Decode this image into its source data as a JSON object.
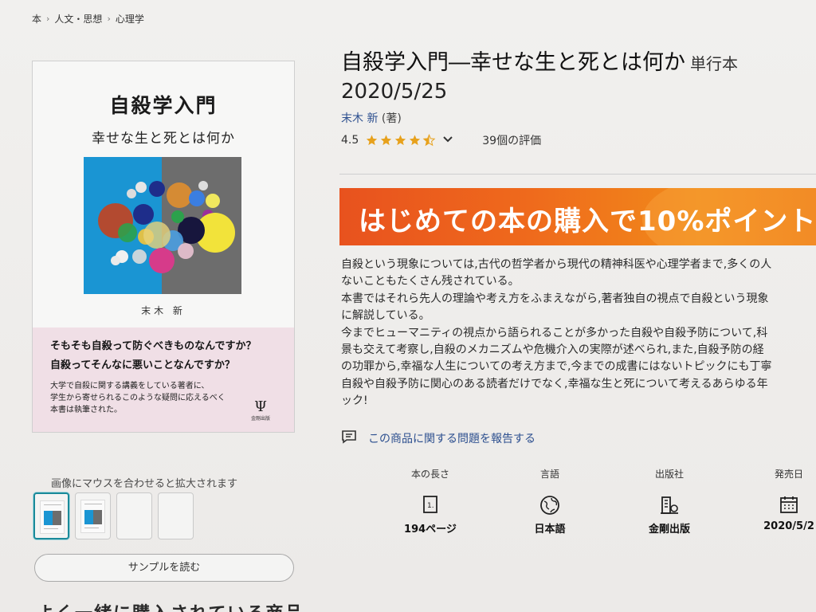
{
  "breadcrumb": [
    "本",
    "人文・思想",
    "心理学"
  ],
  "cover": {
    "title": "自殺学入門",
    "subtitle": "幸せな生と死とは何か",
    "author": "末木 新",
    "question1": "そもそも自殺って防ぐべきものなんですか？",
    "question2": "自殺ってそんなに悪いことなんですか？",
    "blurb": [
      "大学で自殺に関する講義をしている著者に、",
      "学生から寄せられるこのような疑問に応えるべく",
      "本書は執筆された。"
    ],
    "publisher_mark": "Ψ",
    "publisher_name": "金剛出版"
  },
  "hover_hint": "画像にマウスを合わせると拡大されます",
  "sample_button": "サンプルを読む",
  "bottom_cut_text": "よく一緒に購入されている商品",
  "product": {
    "title": "自殺学入門―幸せな生と死とは何か",
    "format": "単行本",
    "date": "2020/5/25",
    "author": "末木 新",
    "author_role": "(著)",
    "rating_value": "4.5",
    "rating_stars": 4.5,
    "rating_count": "39個の評価"
  },
  "promo": {
    "text": "はじめての本の購入で10%ポイント",
    "color_start": "#e8521e",
    "color_end": "#ee7a14"
  },
  "description": [
    "自殺という現象については,古代の哲学者から現代の精神科医や心理学者まで,多くの人",
    "ないこともたくさん残されている。",
    "本書ではそれら先人の理論や考え方をふまえながら,著者独自の視点で自殺という現象",
    "に解説している。",
    "今までヒューマニティの視点から語られることが多かった自殺や自殺予防について,科",
    "景も交えて考察し,自殺のメカニズムや危機介入の実際が述べられ,また,自殺予防の経",
    "の功罪から,幸福な人生についての考え方まで,今までの成書にはないトピックにも丁寧",
    "自殺や自殺予防に関心のある読者だけでなく,幸福な生と死について考えるあらゆる年",
    "ック!"
  ],
  "report_link": "この商品に関する問題を報告する",
  "attributes": [
    {
      "label": "本の長さ",
      "icon": "page-count-icon",
      "value": "194ページ"
    },
    {
      "label": "言語",
      "icon": "globe-icon",
      "value": "日本語"
    },
    {
      "label": "出版社",
      "icon": "building-icon",
      "value": "金剛出版"
    },
    {
      "label": "発売日",
      "icon": "calendar-icon",
      "value": "2020/5/2"
    }
  ],
  "colors": {
    "link": "#2c4f8f",
    "star": "#e7a11c",
    "thumb_active": "#1a8a9a"
  }
}
